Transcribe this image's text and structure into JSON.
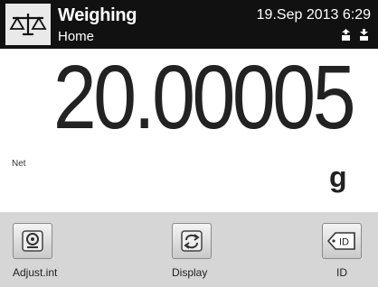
{
  "header": {
    "title": "Weighing",
    "subtitle": "Home",
    "datetime": "19.Sep 2013  6:29"
  },
  "display": {
    "weight": "20.00005",
    "mode": "Net",
    "unit": "g"
  },
  "footer": {
    "buttons": [
      {
        "label": "Adjust.int",
        "icon": "internal-adjustment-icon"
      },
      {
        "label": "Display",
        "icon": "refresh-arrows-icon"
      },
      {
        "label": "ID",
        "icon": "id-tag-icon"
      }
    ]
  },
  "colors": {
    "header_background": "#111111",
    "footer_background": "#d6d6d6",
    "text": "#222222"
  }
}
